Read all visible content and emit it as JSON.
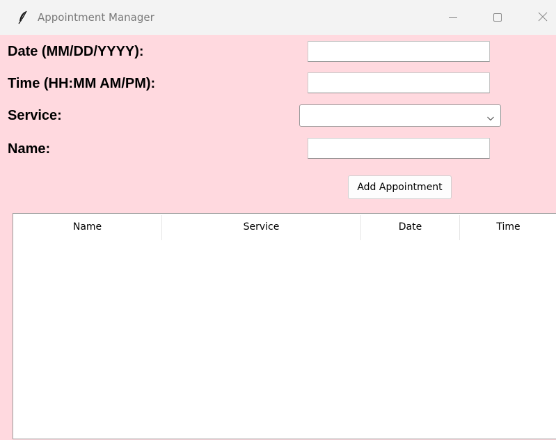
{
  "window": {
    "title": "Appointment Manager",
    "background": "#ffd9df"
  },
  "form": {
    "date_label": "Date (MM/DD/YYYY):",
    "date_value": "",
    "time_label": "Time (HH:MM AM/PM):",
    "time_value": "",
    "service_label": "Service:",
    "service_value": "",
    "name_label": "Name:",
    "name_value": "",
    "add_button_label": "Add Appointment"
  },
  "table": {
    "columns": [
      "Name",
      "Service",
      "Date",
      "Time"
    ],
    "rows": []
  },
  "icons": {
    "app": "feather-icon",
    "minimize": "minimize-icon",
    "maximize": "maximize-icon",
    "close": "close-icon",
    "dropdown": "chevron-down-icon"
  }
}
